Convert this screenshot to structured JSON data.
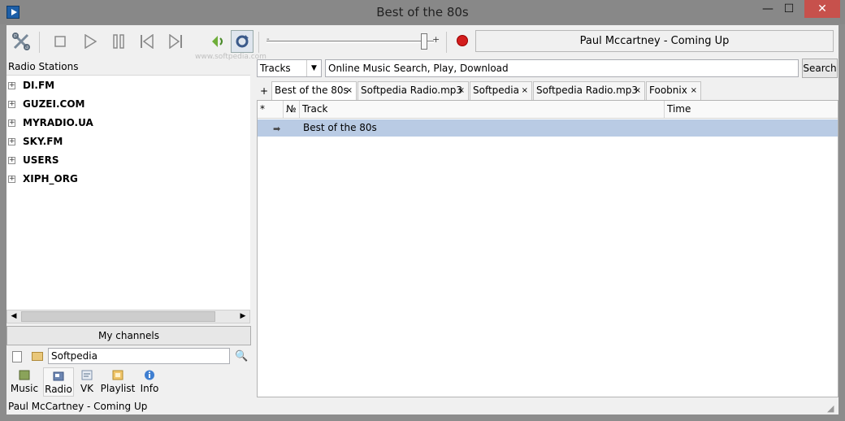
{
  "window": {
    "title": "Best of the 80s"
  },
  "toolbar": {
    "now_playing": "Paul Mccartney - Coming Up",
    "watermark": "www.softpedia.com",
    "seek_minus": "-",
    "seek_plus": "+",
    "icons": [
      "tools-icon",
      "stop-icon",
      "play-icon",
      "pause-icon",
      "previous-icon",
      "next-icon",
      "volume-icon",
      "repeat-icon",
      "record-icon"
    ]
  },
  "radio": {
    "header": "Radio Stations",
    "items": [
      {
        "label": "DI.FM"
      },
      {
        "label": "GUZEI.COM"
      },
      {
        "label": "MYRADIO.UA"
      },
      {
        "label": "SKY.FM"
      },
      {
        "label": "USERS"
      },
      {
        "label": "XIPH_ORG"
      }
    ],
    "my_channels": "My channels",
    "search_value": "Softpedia"
  },
  "nav": {
    "music": "Music",
    "radio": "Radio",
    "vk": "VK",
    "playlist": "Playlist",
    "info": "Info"
  },
  "status": {
    "text": "Paul McCartney - Coming Up"
  },
  "search": {
    "mode": "Tracks",
    "value": "Online Music Search, Play, Download",
    "button": "Search"
  },
  "tabs": {
    "add": "+",
    "items": [
      {
        "label": "Best of the 80s",
        "close": "×"
      },
      {
        "label": "Softpedia Radio.mp3",
        "close": "×"
      },
      {
        "label": "Softpedia",
        "close": "×"
      },
      {
        "label": "Softpedia Radio.mp3",
        "close": "×"
      },
      {
        "label": "Foobnix",
        "close": "×"
      }
    ]
  },
  "tracklist": {
    "columns": {
      "star": "*",
      "num": "№",
      "track": "Track",
      "time": "Time"
    },
    "rows": [
      {
        "num": "",
        "track": "Best of the 80s",
        "time": ""
      }
    ]
  },
  "colors": {
    "accent_selection": "#b9cbe4",
    "record": "#d31d1d",
    "titlebar": "#888888"
  }
}
